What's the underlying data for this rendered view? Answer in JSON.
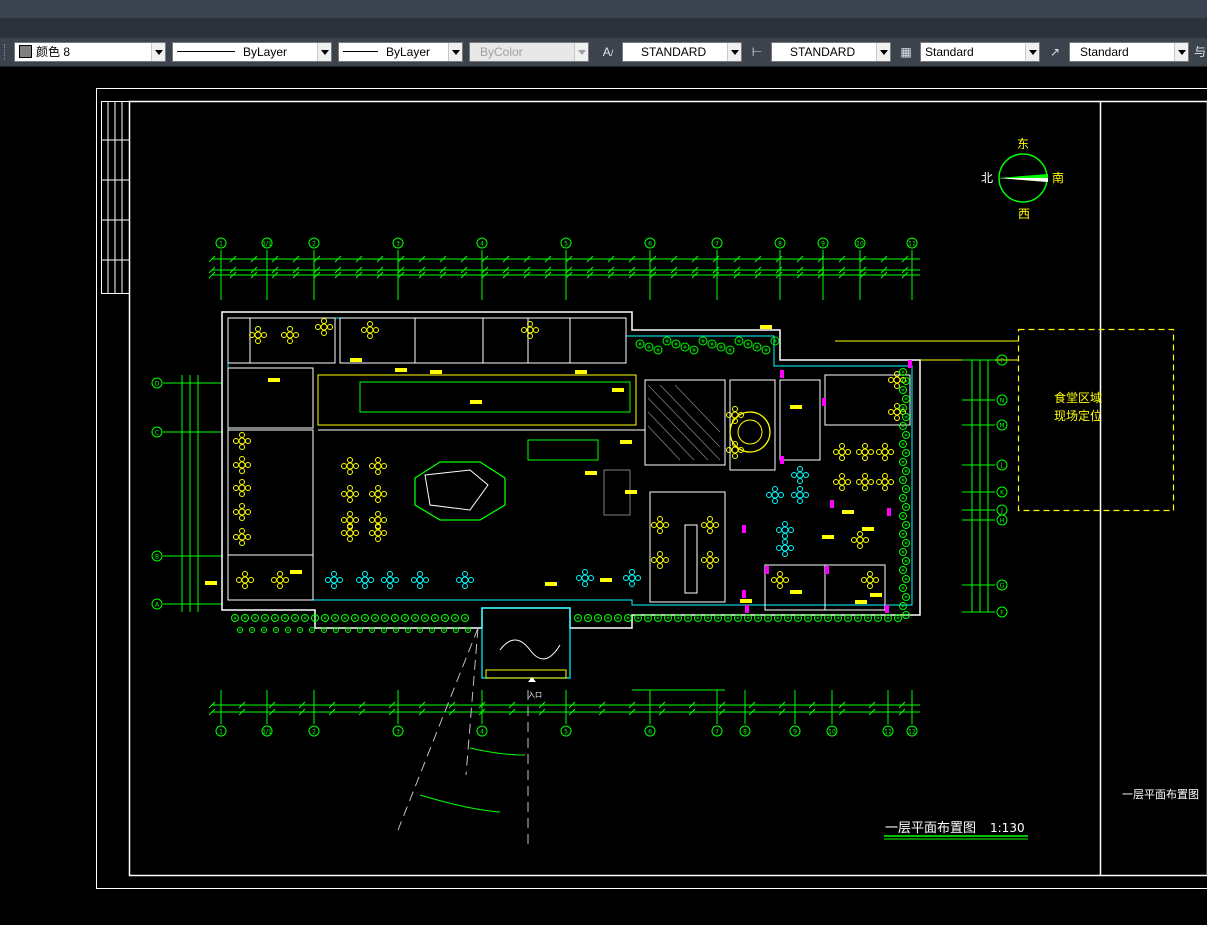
{
  "toolbar": {
    "color_label": "颜色 8",
    "linetype_label": "ByLayer",
    "lineweight_label": "ByLayer",
    "plotstyle_label": "ByColor",
    "text_style": "STANDARD",
    "dim_style": "STANDARD",
    "table_style": "Standard",
    "multileader_style": "Standard",
    "overflow_glyph": "与"
  },
  "drawing": {
    "compass": {
      "east": "东",
      "north": "北",
      "south": "南",
      "west": "西"
    },
    "canteen_zone_line1": "食堂区域",
    "canteen_zone_line2": "现场定位",
    "title_block_text": "一层平面布置图",
    "plan_title": "一层平面布置图",
    "plan_scale": "1:130",
    "entrance_label": "入口",
    "top_axis_labels": [
      "1",
      "1/1",
      "2",
      "3",
      "4",
      "5",
      "6",
      "7",
      "8",
      "9",
      "10",
      "11"
    ],
    "bottom_axis_labels": [
      "1",
      "1/1",
      "2",
      "3",
      "4",
      "5",
      "6",
      "7",
      "8",
      "9",
      "10",
      "11",
      "12"
    ],
    "left_axis_labels": [
      "D",
      "C",
      "B",
      "A"
    ],
    "right_axis_labels": [
      "P",
      "N",
      "M",
      "L",
      "K",
      "J",
      "H",
      "G",
      "F"
    ]
  },
  "colors": {
    "toolbar_bg": "#3c434d",
    "canvas_bg": "#000000",
    "cad_yellow": "#ffff00",
    "cad_green": "#00ff00",
    "cad_cyan": "#00ffff",
    "cad_magenta": "#ff00ff",
    "cad_white": "#ffffff"
  }
}
